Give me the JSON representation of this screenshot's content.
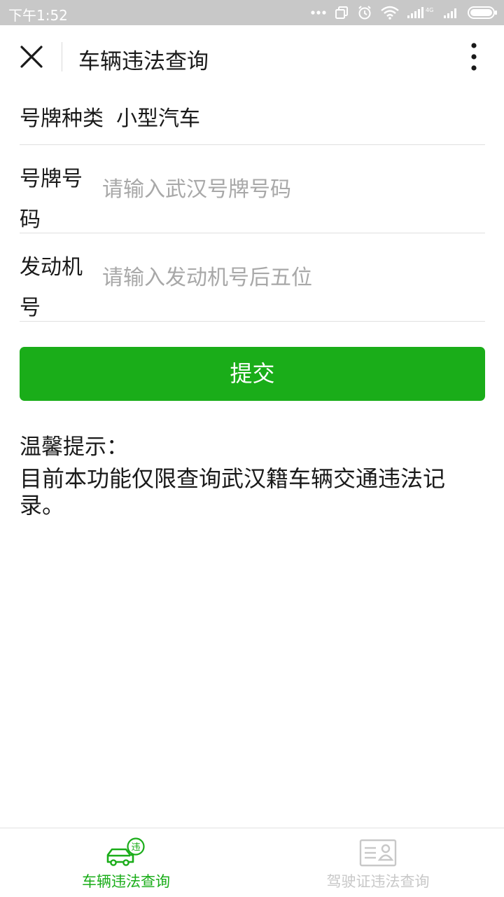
{
  "status_bar": {
    "time": "下午1:52",
    "icons": [
      "more-dots-icon",
      "sim-copy-icon",
      "alarm-icon",
      "wifi-icon",
      "4g-signal-icon",
      "signal-icon",
      "battery-icon"
    ],
    "network_text": "4G"
  },
  "header": {
    "title": "车辆违法查询",
    "close_icon": "close-icon",
    "menu_icon": "more-vertical-icon"
  },
  "form": {
    "plate_type_label": "号牌种类",
    "plate_type_value": "小型汽车",
    "plate_number_label": "号牌号码",
    "plate_number_placeholder": "请输入武汉号牌号码",
    "plate_number_value": "",
    "engine_label": "发动机号",
    "engine_placeholder": "请输入发动机号后五位",
    "engine_value": "",
    "submit_label": "提交"
  },
  "tips": {
    "title": "温馨提示：",
    "text": "目前本功能仅限查询武汉籍车辆交通违法记录。"
  },
  "tabbar": {
    "tabs": [
      {
        "label": "车辆违法查询",
        "icon": "car-violation-icon",
        "icon_badge": "违",
        "active": true
      },
      {
        "label": "驾驶证违法查询",
        "icon": "driver-license-icon",
        "active": false
      }
    ]
  },
  "colors": {
    "accent": "#1aad19",
    "status_bar_bg": "#c8c8c8",
    "placeholder": "#a8a8a8",
    "inactive_tab": "#c8c8c8"
  }
}
